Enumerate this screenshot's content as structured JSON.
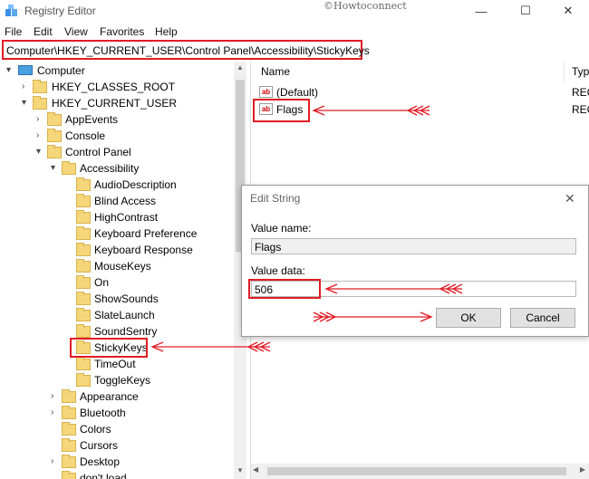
{
  "window": {
    "title": "Registry Editor",
    "watermark": "©Howtoconnect"
  },
  "menu": [
    "File",
    "Edit",
    "View",
    "Favorites",
    "Help"
  ],
  "address": "Computer\\HKEY_CURRENT_USER\\Control Panel\\Accessibility\\StickyKeys",
  "tree": {
    "root": "Computer",
    "hkcr": "HKEY_CLASSES_ROOT",
    "hkcu": "HKEY_CURRENT_USER",
    "appevents": "AppEvents",
    "console": "Console",
    "control_panel": "Control Panel",
    "accessibility": "Accessibility",
    "acc_children": [
      "AudioDescription",
      "Blind Access",
      "HighContrast",
      "Keyboard Preference",
      "Keyboard Response",
      "MouseKeys",
      "On",
      "ShowSounds",
      "SlateLaunch",
      "SoundSentry",
      "StickyKeys",
      "TimeOut",
      "ToggleKeys"
    ],
    "cp_children": [
      "Appearance",
      "Bluetooth",
      "Colors",
      "Cursors",
      "Desktop",
      "don't load"
    ],
    "selected": "StickyKeys"
  },
  "values": {
    "col_name": "Name",
    "col_type": "Typ",
    "rows": [
      {
        "name": "(Default)",
        "type": "REG"
      },
      {
        "name": "Flags",
        "type": "REG"
      }
    ],
    "icon": "ab"
  },
  "dialog": {
    "title": "Edit String",
    "value_name_label": "Value name:",
    "value_name": "Flags",
    "value_data_label": "Value data:",
    "value_data": "506",
    "ok": "OK",
    "cancel": "Cancel"
  },
  "colors": {
    "highlight": "#e01b24",
    "folder": "#f5d67a"
  }
}
